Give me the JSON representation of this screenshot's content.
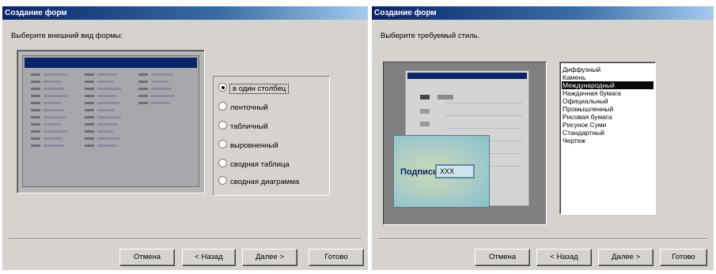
{
  "left": {
    "title": "Создание форм",
    "prompt": "Выберите внешний вид формы:",
    "options": [
      {
        "label": "в один столбец",
        "selected": true
      },
      {
        "label": "ленточный",
        "selected": false
      },
      {
        "label": "табличный",
        "selected": false
      },
      {
        "label": "выровненный",
        "selected": false
      },
      {
        "label": "сводная таблица",
        "selected": false
      },
      {
        "label": "сводная диаграмма",
        "selected": false
      }
    ],
    "buttons": {
      "cancel": "Отмена",
      "back": "< Назад",
      "next": "Далее >",
      "finish": "Готово"
    }
  },
  "right": {
    "title": "Создание форм",
    "prompt": "Выберите требуемый стиль.",
    "preview_label": "Подпись",
    "preview_value": "ХХХ",
    "styles": [
      "Диффузный",
      "Камень",
      "Международный",
      "Наждачная бумага",
      "Официальный",
      "Промышленный",
      "Рисовая бумага",
      "Рисунок Суми",
      "Стандартный",
      "Чертеж"
    ],
    "selected_style": "Международный",
    "buttons": {
      "cancel": "Отмена",
      "back": "< Назад",
      "next": "Далее >",
      "finish": "Готово"
    }
  },
  "colors": {
    "title_bar": "#0a246a",
    "dialog_bg": "#d6d3ce",
    "selection": "#0a0a0a"
  }
}
